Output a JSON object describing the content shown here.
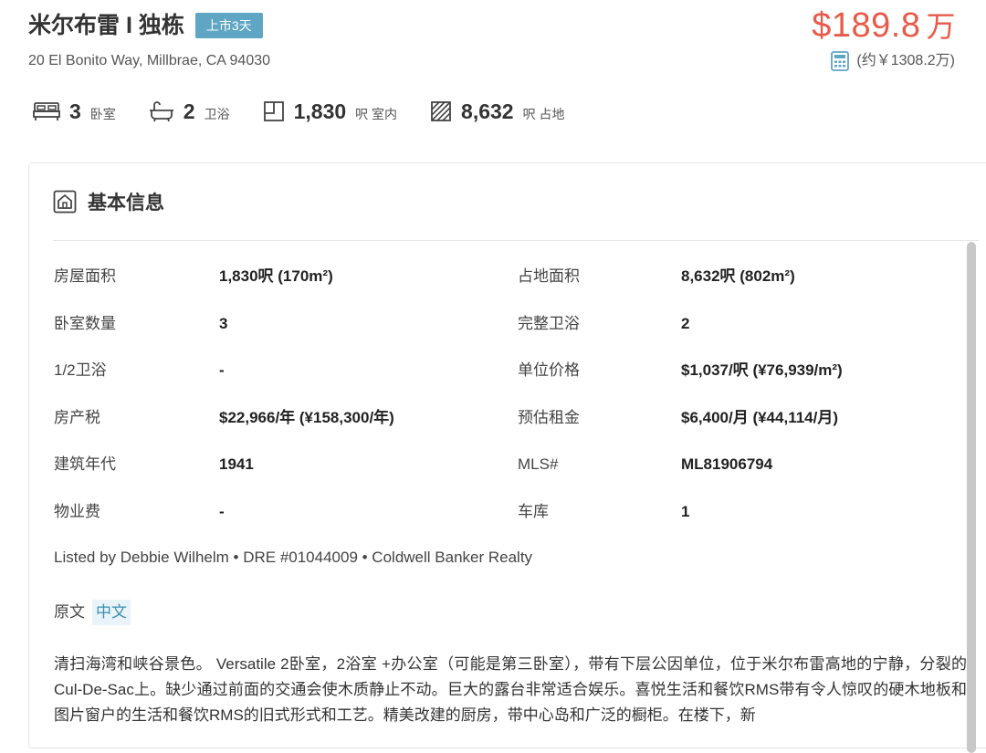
{
  "listing": {
    "title": "米尔布雷 I 独栋",
    "badge": "上市3天",
    "address": "20 El Bonito Way, Millbrae, CA 94030",
    "price": "$189.8",
    "price_unit": "万",
    "price_cny": "(约￥1308.2万)"
  },
  "stats": [
    {
      "icon": "bed-icon",
      "value": "3",
      "unit": "卧室"
    },
    {
      "icon": "bathtub-icon",
      "value": "2",
      "unit": "卫浴"
    },
    {
      "icon": "interior-area-icon",
      "value": "1,830",
      "unit": "呎 室内"
    },
    {
      "icon": "lot-area-icon",
      "value": "8,632",
      "unit": "呎 占地"
    }
  ],
  "basic_info": {
    "title": "基本信息",
    "rows": [
      {
        "l1": "房屋面积",
        "v1": "1,830呎 (170m²)",
        "l2": "占地面积",
        "v2": "8,632呎 (802m²)"
      },
      {
        "l1": "卧室数量",
        "v1": "3",
        "l2": "完整卫浴",
        "v2": "2"
      },
      {
        "l1": "1/2卫浴",
        "v1": "-",
        "l2": "单位价格",
        "v2": "$1,037/呎 (¥76,939/m²)"
      },
      {
        "l1": "房产税",
        "v1": "$22,966/年 (¥158,300/年)",
        "l2": "预估租金",
        "v2": "$6,400/月 (¥44,114/月)"
      },
      {
        "l1": "建筑年代",
        "v1": "1941",
        "l2": "MLS#",
        "v2": "ML81906794"
      },
      {
        "l1": "物业费",
        "v1": "-",
        "l2": "车库",
        "v2": "1"
      }
    ],
    "listed_by": "Listed by Debbie Wilhelm • DRE #01044009 • Coldwell Banker Realty",
    "lang_original": "原文",
    "lang_chinese": "中文",
    "description": "清扫海湾和峡谷景色。 Versatile 2卧室，2浴室 +办公室（可能是第三卧室），带有下层公因单位，位于米尔布雷高地的宁静，分裂的Cul-De-Sac上。缺少通过前面的交通会使木质静止不动。巨大的露台非常适合娱乐。喜悦生活和餐饮RMS带有令人惊叹的硬木地板和图片窗户的生活和餐饮RMS的旧式形式和工艺。精美改建的厨房，带中心岛和广泛的橱柜。在楼下，新"
  },
  "colors": {
    "price": "#e85a4a",
    "badge": "#5ea6c4",
    "link": "#3a8fb5"
  }
}
